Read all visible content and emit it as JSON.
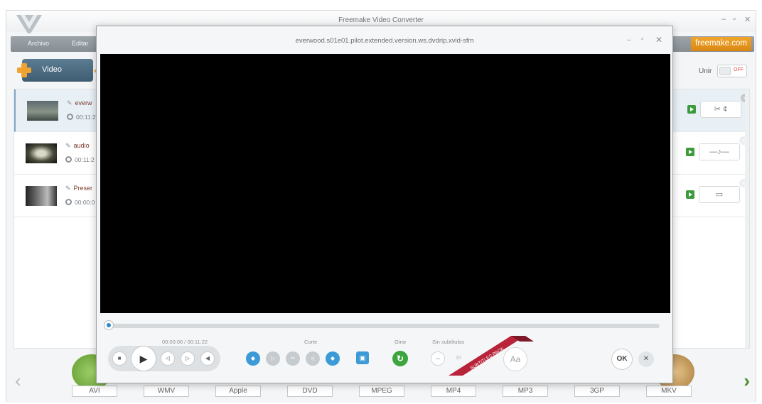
{
  "app": {
    "title": "Freemake Video Converter",
    "minimize": "–",
    "maximize": "▫",
    "close": "✕"
  },
  "menu": {
    "items": [
      "Archivo",
      "Editar"
    ],
    "brand": "freemake.com"
  },
  "toolbar": {
    "video_label": "Video",
    "unir_label": "Unir",
    "unir_state": "OFF"
  },
  "files": [
    {
      "name": "everw",
      "duration": "00:11:2"
    },
    {
      "name": "audio",
      "duration": "00:11:2"
    },
    {
      "name": "Preser",
      "duration": "00:00:0"
    }
  ],
  "formats": [
    "AVI",
    "WMV",
    "Apple",
    "DVD",
    "MPEG",
    "MP4",
    "MP3",
    "3GP",
    "MKV"
  ],
  "player": {
    "title": "everwood.s01e01.pilot.extended.version.ws.dvdrip.xvid-sfm",
    "minimize": "–",
    "maximize": "▫",
    "close": "✕",
    "time": "00:00:00 / 00:11:22",
    "seek_progress": 0.0,
    "corte_label": "Corte",
    "girar_label": "Girar",
    "subtitles_label": "Sin subtítulos",
    "subtitle_size": "20",
    "ribbon_text": "SUBTITLES PACK",
    "aa_label": "Aa",
    "ok_label": "OK",
    "cancel_label": "✕"
  },
  "colors": {
    "accent_blue": "#3c9bd7",
    "green": "#3da53d",
    "ribbon_red": "#b8233a",
    "brand_orange": "#e6951d"
  }
}
